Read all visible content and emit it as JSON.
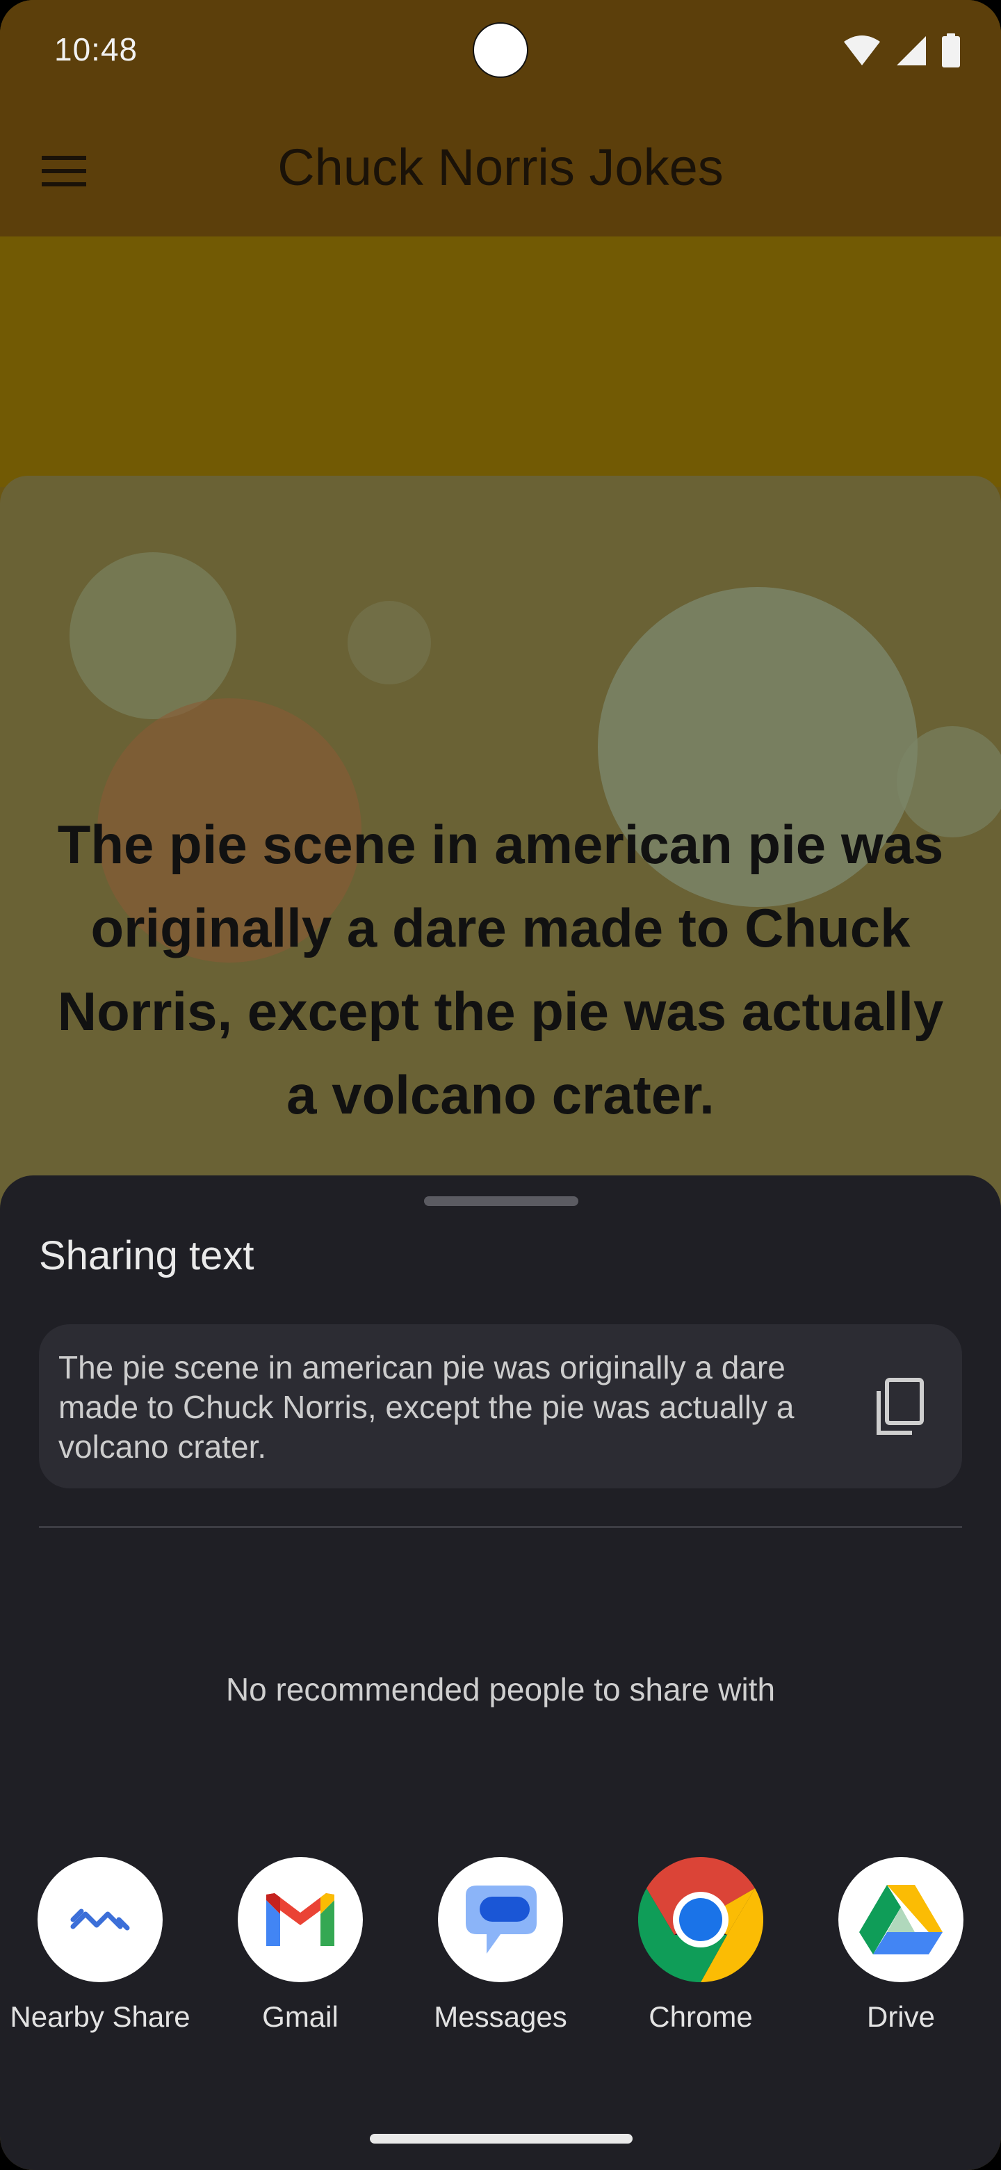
{
  "status_bar": {
    "time": "10:48"
  },
  "app_bar": {
    "title": "Chuck Norris Jokes",
    "menu_icon": "hamburger-menu-icon"
  },
  "joke": {
    "text": "The pie scene in american pie was originally a dare made to Chuck Norris, except the pie was actually a volcano crater."
  },
  "share_sheet": {
    "title": "Sharing text",
    "preview_text": "The pie scene in american pie was originally a dare made to Chuck Norris, except the pie was actually a volcano crater.",
    "copy_icon": "copy-icon",
    "no_people_text": "No recommended people to share with",
    "apps": [
      {
        "label": "Nearby Share",
        "icon": "nearby-share-icon"
      },
      {
        "label": "Gmail",
        "icon": "gmail-icon"
      },
      {
        "label": "Messages",
        "icon": "messages-icon"
      },
      {
        "label": "Chrome",
        "icon": "chrome-icon"
      },
      {
        "label": "Drive",
        "icon": "drive-icon"
      }
    ]
  },
  "colors": {
    "app_bar": "#5c3f0b",
    "sheet_bg": "#1f1f25",
    "preview_bg": "#2c2c33",
    "card_bg": "#6a6235"
  }
}
